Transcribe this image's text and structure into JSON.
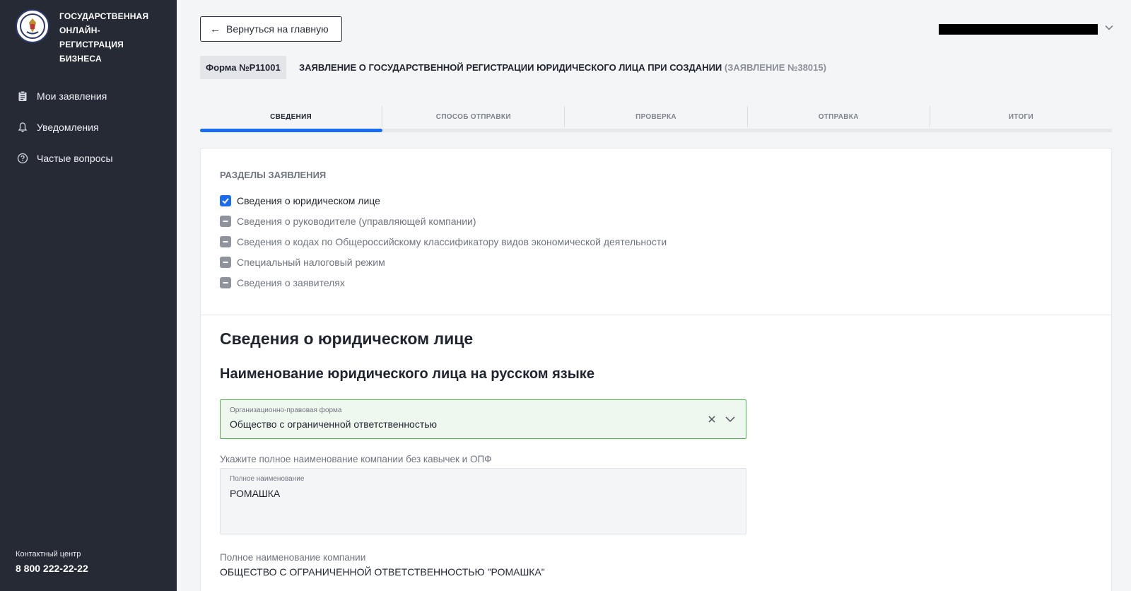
{
  "brand": {
    "title_lines": [
      "ГОСУДАРСТВЕННАЯ",
      "ОНЛАЙН-РЕГИСТРАЦИЯ",
      "БИЗНЕСА"
    ]
  },
  "nav": {
    "items": [
      {
        "label": "Мои заявления",
        "icon": "clipboard-icon"
      },
      {
        "label": "Уведомления",
        "icon": "bell-icon"
      },
      {
        "label": "Частые вопросы",
        "icon": "question-circle-icon"
      }
    ]
  },
  "contact": {
    "label": "Контактный центр",
    "phone": "8 800 222-22-22"
  },
  "header": {
    "back_label": "Вернуться на главную"
  },
  "form": {
    "badge": "Форма №Р11001",
    "title": "ЗАЯВЛЕНИЕ О ГОСУДАРСТВЕННОЙ РЕГИСТРАЦИИ ЮРИДИЧЕСКОГО ЛИЦА ПРИ СОЗДАНИИ",
    "number": "(ЗАЯВЛЕНИЕ №38015)"
  },
  "stepper": {
    "steps": [
      "СВЕДЕНИЯ",
      "СПОСОБ ОТПРАВКИ",
      "ПРОВЕРКА",
      "ОТПРАВКА",
      "ИТОГИ"
    ],
    "active_index": 0,
    "progress_fraction": 0.2,
    "accent_color": "#1a6cf2"
  },
  "sections": {
    "title": "РАЗДЕЛЫ ЗАЯВЛЕНИЯ",
    "items": [
      {
        "label": "Сведения о юридическом лице",
        "state": "checked"
      },
      {
        "label": "Сведения о руководителе (управляющей компании)",
        "state": "partial"
      },
      {
        "label": "Сведения о кодах по Общероссийскому классификатору видов экономической деятельности",
        "state": "partial"
      },
      {
        "label": "Специальный налоговый режим",
        "state": "partial"
      },
      {
        "label": "Сведения о заявителях",
        "state": "partial"
      }
    ]
  },
  "entity": {
    "heading": "Сведения о юридическом лице",
    "subheading": "Наименование юридического лица на русском языке",
    "legal_form": {
      "label": "Организационно-правовая форма",
      "value": "Общество с ограниченной ответственностью",
      "border_color": "#4cae4f"
    },
    "name_hint": "Укажите полное наименование компании без кавычек и ОПФ",
    "name_field": {
      "label": "Полное наименование",
      "value": "РОМАШКА"
    },
    "full_name_label": "Полное наименование компании",
    "full_name_value": "ОБЩЕСТВО С ОГРАНИЧЕННОЙ ОТВЕТСТВЕННОСТЬЮ \"РОМАШКА\""
  }
}
